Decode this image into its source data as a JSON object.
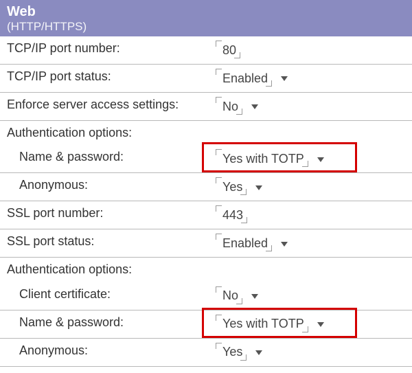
{
  "header": {
    "title": "Web",
    "subtitle": "(HTTP/HTTPS)"
  },
  "rows": {
    "tcp_port_label": "TCP/IP port number:",
    "tcp_port_value": "80",
    "tcp_status_label": "TCP/IP port status:",
    "tcp_status_value": "Enabled",
    "enforce_label": "Enforce server access settings:",
    "enforce_value": "No",
    "auth1_header": "Authentication options:",
    "auth1_namepw_label": "Name & password:",
    "auth1_namepw_value": "Yes with TOTP",
    "auth1_anon_label": "Anonymous:",
    "auth1_anon_value": "Yes",
    "ssl_port_label": "SSL port number:",
    "ssl_port_value": "443",
    "ssl_status_label": "SSL port status:",
    "ssl_status_value": "Enabled",
    "auth2_header": "Authentication options:",
    "auth2_cert_label": "Client certificate:",
    "auth2_cert_value": "No",
    "auth2_namepw_label": "Name & password:",
    "auth2_namepw_value": "Yes with TOTP",
    "auth2_anon_label": "Anonymous:",
    "auth2_anon_value": "Yes"
  }
}
